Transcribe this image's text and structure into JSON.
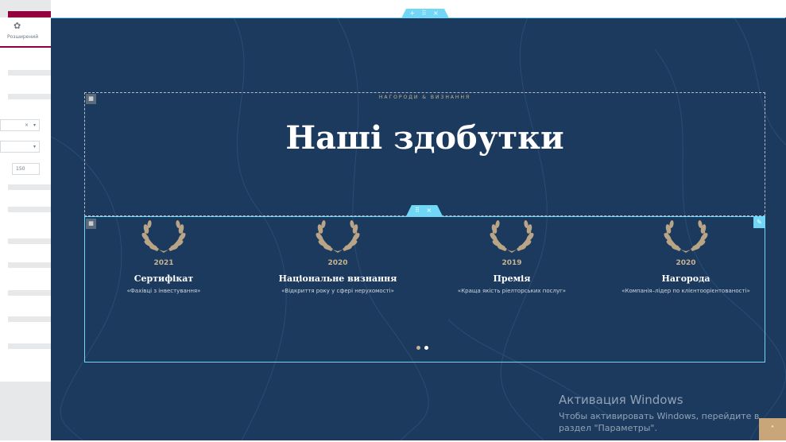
{
  "panel": {
    "tab_label": "Розширений",
    "gear_icon": "gear-icon",
    "select_clear": "×",
    "select_caret": "▾",
    "number_value": "150",
    "collapse_arrow": "‹"
  },
  "canvas": {
    "top_handle": "+ ⠿ ×",
    "mid_handle": "⠿ ×",
    "section_icon": "▦",
    "edit_icon": "✎",
    "eyebrow": "НАГОРОДИ & ВИЗНАННЯ",
    "heading": "Наші здобутки",
    "awards": [
      {
        "year": "2021",
        "title": "Сертифікат",
        "desc": "«Фахівці з інвестування»"
      },
      {
        "year": "2020",
        "title": "Національне визнання",
        "desc": "«Відкриття року у сфері нерухомості»"
      },
      {
        "year": "2019",
        "title": "Премія",
        "desc": "«Краща якість ріелторських послуг»"
      },
      {
        "year": "2020",
        "title": "Нагорода",
        "desc": "«Компанія–лідер по клієнтоорієнтованості»"
      }
    ],
    "colors": {
      "background": "#1b3a5e",
      "accent": "#c8b493",
      "handle": "#71d7f7"
    }
  },
  "activation": {
    "title": "Активация Windows",
    "line1": "Чтобы активировать Windows, перейдите в",
    "line2": "раздел \"Параметры\"."
  },
  "scroll_top": "˄"
}
